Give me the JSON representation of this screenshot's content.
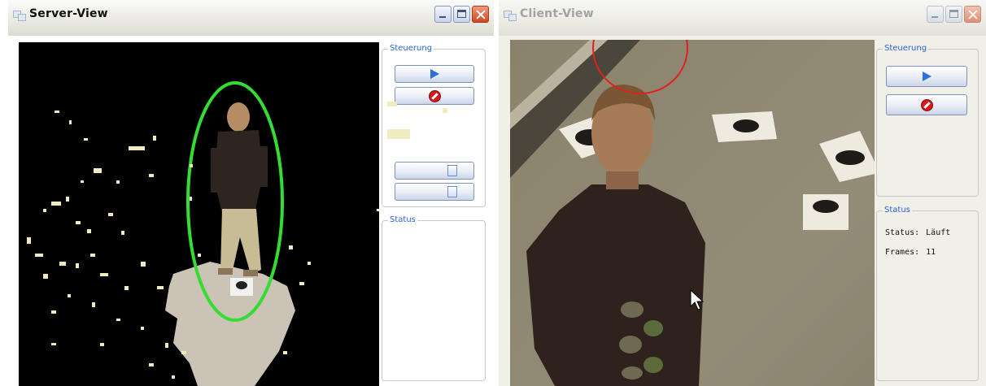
{
  "server_window": {
    "title": "Server-View",
    "title_icon": "app-window-icon",
    "controls": [
      "minimize-icon",
      "maximize-icon",
      "close-icon"
    ],
    "panels": {
      "steuerung_label": "Steuerung",
      "status_label": "Status"
    },
    "buttons": {
      "play_icon": "play-icon",
      "stop_icon": "stop-icon"
    },
    "colors": {
      "tracking_ellipse": "#33dd33",
      "legend_text": "#2b5fd9"
    }
  },
  "client_window": {
    "title": "Client-View",
    "title_icon": "app-window-icon",
    "controls": [
      "minimize-icon",
      "maximize-icon",
      "close-icon"
    ],
    "panels": {
      "steuerung_label": "Steuerung",
      "status_label": "Status"
    },
    "buttons": {
      "play_icon": "play-icon",
      "stop_icon": "stop-icon"
    },
    "status": {
      "status_key": "Status:",
      "status_value": "Läuft",
      "frames_key": "Frames:",
      "frames_value": "11"
    },
    "colors": {
      "tracking_ellipse": "#dd2222",
      "legend_text": "#2b5fd9"
    }
  }
}
